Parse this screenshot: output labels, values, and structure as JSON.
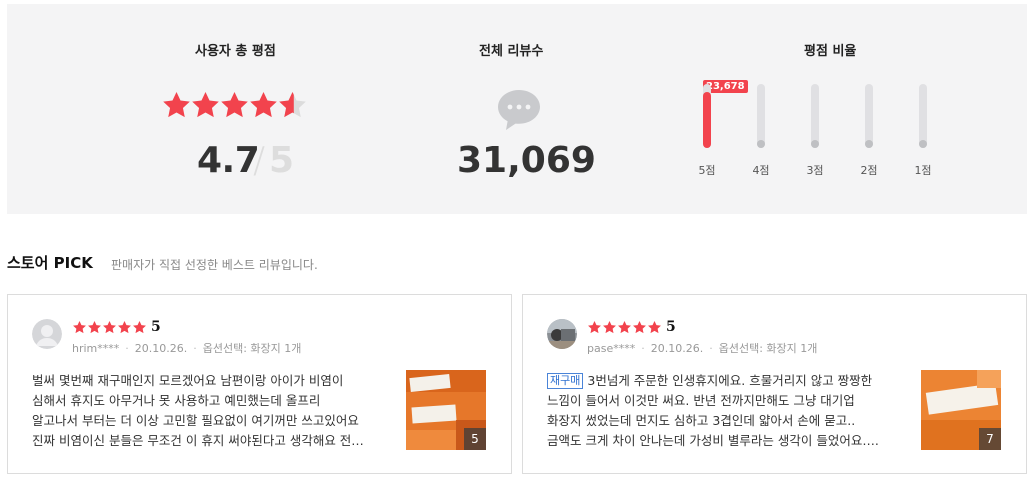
{
  "summary": {
    "total_rating_title": "사용자 총 평점",
    "rating_value": "4.7",
    "rating_sep": "/",
    "rating_max": "5",
    "rating_fraction": 0.94,
    "total_reviews_title": "전체 리뷰수",
    "total_reviews": "31,069",
    "ratio_title": "평점 비율",
    "top_badge": "23,678",
    "bars": [
      {
        "label": "5점",
        "fill": 1.0
      },
      {
        "label": "4점",
        "fill": 0
      },
      {
        "label": "3점",
        "fill": 0
      },
      {
        "label": "2점",
        "fill": 0
      },
      {
        "label": "1점",
        "fill": 0
      }
    ],
    "colors": {
      "accent": "#f2434d",
      "panel": "#f4f4f5",
      "track": "#e0e0e3"
    }
  },
  "store_pick": {
    "title": "스토어 PICK",
    "subtitle": "판매자가 직접 선정한 베스트 리뷰입니다."
  },
  "reviews": [
    {
      "score": "5",
      "user": "hrim****",
      "date": "20.10.26.",
      "option": "옵션선택: 화장지 1개",
      "tag": "",
      "lines": [
        "벌써 몇번째 재구매인지 모르겠어요 남편이랑 아이가 비염이",
        "심해서 휴지도 아무거나 못 사용하고 예민했는데 올프리",
        "알고나서 부터는 더 이상 고민할 필요없이 여기꺼만 쓰고있어요",
        "진짜 비염이신 분들은 무조건 이 휴지 써야된다고 생각해요 전…"
      ],
      "photo_count": "5",
      "avatar_icon": "default-user-icon"
    },
    {
      "score": "5",
      "user": "pase****",
      "date": "20.10.26.",
      "option": "옵션선택: 화장지 1개",
      "tag": "재구매",
      "lines": [
        "3번넘게 주문한 인생휴지에요. 흐물거리지 않고 짱짱한",
        "느낌이 들어서 이것만 써요. 반년 전까지만해도 그냥 대기업",
        "화장지 썼었는데 먼지도 심하고 3겹인데 얇아서 손에 묻고..",
        "금액도 크게 차이 안나는데 가성비 별루라는 생각이 들었어요…."
      ],
      "photo_count": "7",
      "avatar_icon": "user-photo"
    }
  ]
}
